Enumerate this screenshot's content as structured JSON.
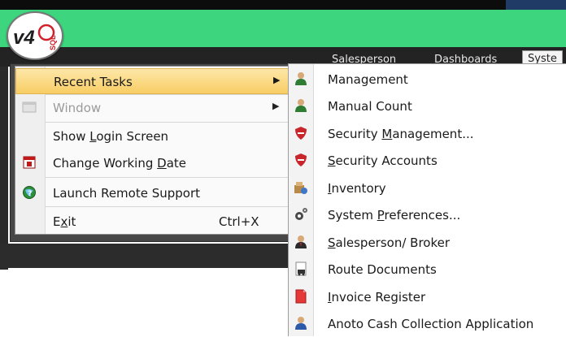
{
  "logo": {
    "text_main": "v4",
    "text_sub": "SQL"
  },
  "ribbon": {
    "tabs": [
      {
        "label": "Salesperson",
        "active": false
      },
      {
        "label": "Dashboards",
        "active": false
      },
      {
        "label": "Syste",
        "active": true
      }
    ]
  },
  "app_menu": {
    "items": [
      {
        "label": "Recent Tasks",
        "has_submenu": true,
        "highlighted": true
      },
      {
        "label": "Window",
        "has_submenu": true,
        "disabled": true,
        "icon": "window-icon"
      },
      {
        "pre": "Show ",
        "u": "L",
        "post": "ogin Screen"
      },
      {
        "pre": "Change Working ",
        "u": "D",
        "post": "ate",
        "icon": "calendar-icon"
      },
      {
        "label": "Launch Remote Support",
        "icon": "remote-support-icon"
      },
      {
        "pre": "E",
        "u": "x",
        "post": "it",
        "shortcut": "Ctrl+X"
      }
    ]
  },
  "recent_tasks": {
    "items": [
      {
        "pre": "",
        "u": "",
        "post": "Management",
        "icon": "user-green-icon"
      },
      {
        "pre": "",
        "u": "",
        "post": "Manual Count",
        "icon": "user-green-icon"
      },
      {
        "pre": "Security ",
        "u": "M",
        "post": "anagement...",
        "icon": "shield-icon"
      },
      {
        "pre": "",
        "u": "S",
        "post": "ecurity Accounts",
        "icon": "shield-icon"
      },
      {
        "pre": "",
        "u": "I",
        "post": "nventory",
        "icon": "inventory-icon"
      },
      {
        "pre": "System ",
        "u": "P",
        "post": "references...",
        "icon": "gears-icon"
      },
      {
        "pre": "",
        "u": "S",
        "post": "alesperson/ Broker",
        "icon": "salesperson-icon"
      },
      {
        "pre": "",
        "u": "",
        "post": "Route Documents",
        "icon": "route-documents-icon"
      },
      {
        "pre": "",
        "u": "I",
        "post": "nvoice Register",
        "icon": "invoice-register-icon"
      },
      {
        "pre": "",
        "u": "",
        "post": "Anoto Cash Collection Application",
        "icon": "user-blue-icon"
      }
    ]
  },
  "colors": {
    "brand_green": "#3dd67e",
    "highlight": "#f8cd64",
    "logo_red": "#d0202a"
  }
}
